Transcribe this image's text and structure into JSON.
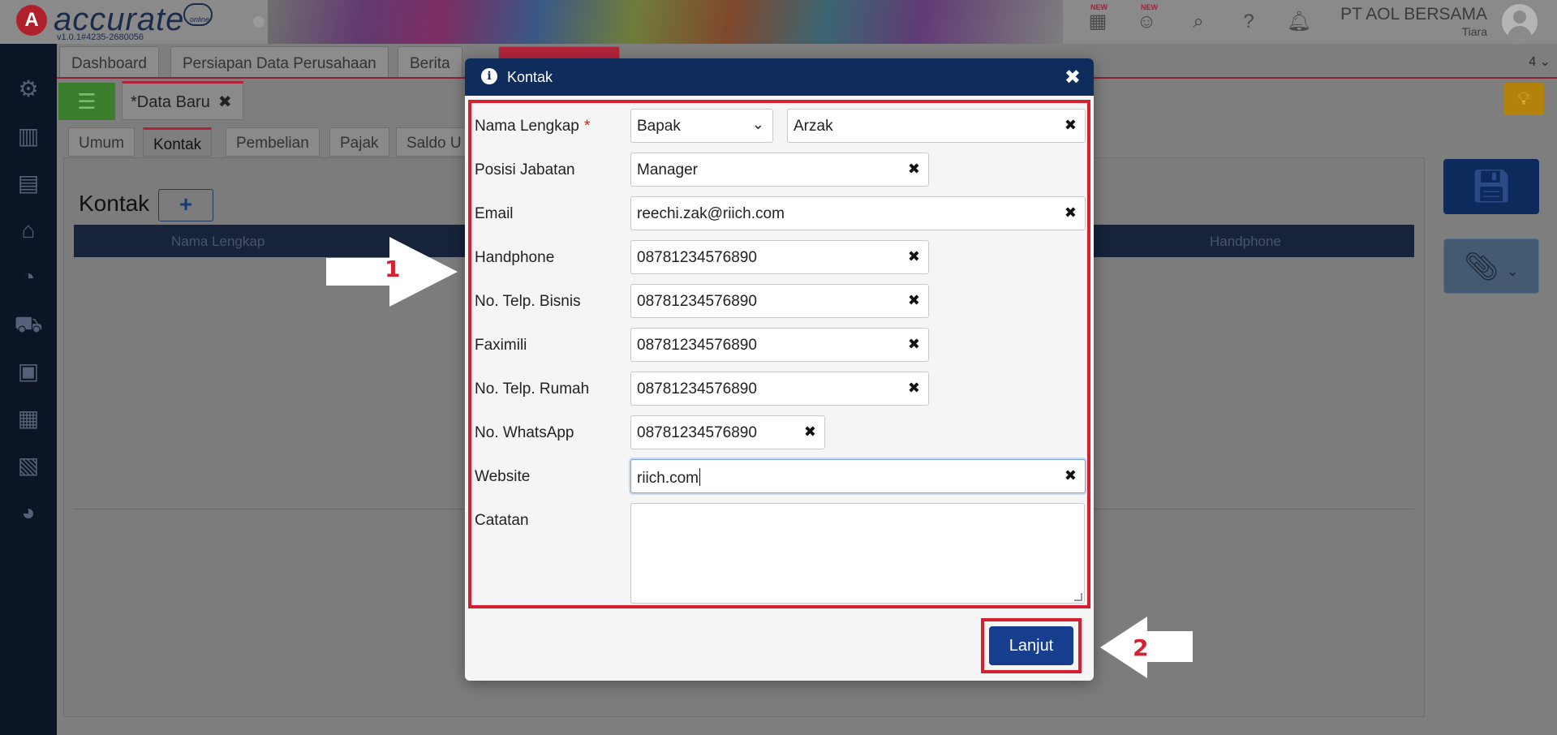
{
  "app": {
    "logo": "accurate",
    "logo_cloud": "online",
    "version": "v1.0.1#4235-2680056",
    "company": "PT AOL BERSAMA",
    "user": "Tiara",
    "badge_new": "NEW"
  },
  "main_tabs": [
    {
      "label": "Dashboard"
    },
    {
      "label": "Persiapan Data Perusahaan"
    },
    {
      "label": "Berita"
    },
    {
      "label": ""
    }
  ],
  "tab_count": "4",
  "doc_tab": {
    "label": "*Data Baru",
    "close": "✖"
  },
  "sub_tabs": [
    "Umum",
    "Kontak",
    "Pembelian",
    "Pajak",
    "Saldo U"
  ],
  "panel": {
    "title": "Kontak",
    "add_label": "+",
    "columns": [
      "Nama Lengkap",
      "Handphone"
    ]
  },
  "dialog": {
    "title": "Kontak",
    "close": "✖",
    "fields": {
      "nama": {
        "label": "Nama Lengkap",
        "required": "*",
        "salutation": "Bapak",
        "value": "Arzak"
      },
      "posisi": {
        "label": "Posisi Jabatan",
        "value": "Manager"
      },
      "email": {
        "label": "Email",
        "value": "reechi.zak@riich.com"
      },
      "handphone": {
        "label": "Handphone",
        "value": "08781234576890"
      },
      "telp_bisnis": {
        "label": "No. Telp. Bisnis",
        "value": "08781234576890"
      },
      "faximili": {
        "label": "Faximili",
        "value": "08781234576890"
      },
      "telp_rumah": {
        "label": "No. Telp. Rumah",
        "value": "08781234576890"
      },
      "whatsapp": {
        "label": "No. WhatsApp",
        "value": "08781234576890"
      },
      "website": {
        "label": "Website",
        "value": "riich.com"
      },
      "catatan": {
        "label": "Catatan",
        "value": ""
      }
    },
    "clear_glyph": "✖",
    "submit_label": "Lanjut"
  },
  "annotations": {
    "step1": "1",
    "step2": "2"
  },
  "colors": {
    "accent": "#183e8f",
    "header": "#0f2d5c",
    "highlight": "#d4202f",
    "sidebar": "#0c1526"
  }
}
